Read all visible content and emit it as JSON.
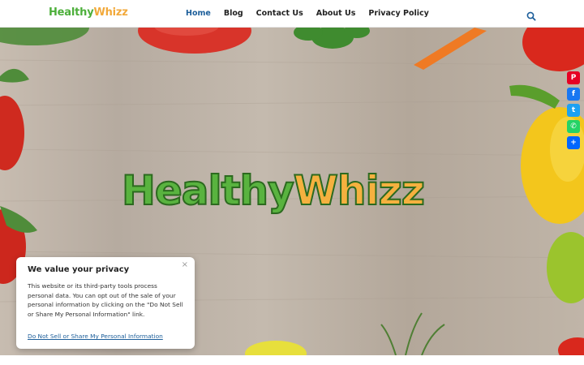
{
  "header": {
    "logo_green": "Healthy",
    "logo_orange": "Whizz",
    "nav": [
      "Home",
      "Blog",
      "Contact Us",
      "About Us",
      "Privacy Policy"
    ],
    "search_icon": "search-icon"
  },
  "hero": {
    "logo_green": "Healthy",
    "logo_orange": "Whizz"
  },
  "share": [
    {
      "name": "pinterest-icon",
      "glyph": "P",
      "color": "#e60023"
    },
    {
      "name": "facebook-icon",
      "glyph": "f",
      "color": "#1877f2"
    },
    {
      "name": "twitter-icon",
      "glyph": "t",
      "color": "#1da1f2"
    },
    {
      "name": "whatsapp-icon",
      "glyph": "✆",
      "color": "#25d366"
    },
    {
      "name": "share-icon",
      "glyph": "+",
      "color": "#0166ff"
    }
  ],
  "consent": {
    "title": "We value your privacy",
    "body": "This website or its third-party tools process personal data. You can opt out of the sale of your personal information by clicking on the \"Do Not Sell or Share My Personal Information\" link.",
    "link": "Do Not Sell or Share My Personal Information",
    "close": "×"
  },
  "colors": {
    "nav_active": "#1c5e9a",
    "brand_green": "#4caf3a",
    "brand_orange": "#f2a93b"
  }
}
